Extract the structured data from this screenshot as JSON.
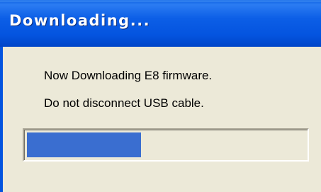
{
  "window": {
    "title": "Downloading..."
  },
  "message": {
    "line1": "Now Downloading E8 firmware.",
    "line2": "Do not disconnect USB cable."
  },
  "progress": {
    "fraction": 0.41,
    "fill_color": "#3a6ed0"
  },
  "colors": {
    "titlebar": "#0454df",
    "dialog_background": "#ece9d8"
  }
}
